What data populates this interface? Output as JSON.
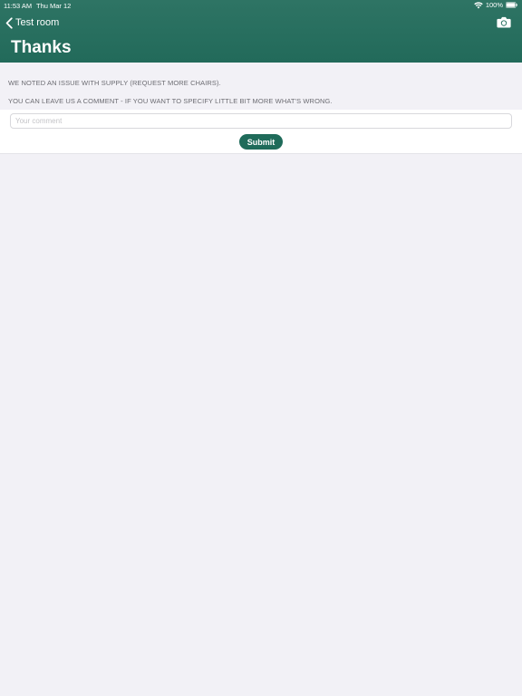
{
  "status_bar": {
    "time": "11:53 AM",
    "date": "Thu Mar 12",
    "battery": "100%"
  },
  "nav": {
    "back_label": "Test room",
    "title": "Thanks"
  },
  "content": {
    "message_1": "WE NOTED AN ISSUE WITH SUPPLY (REQUEST MORE CHAIRS).",
    "message_2": "YOU CAN LEAVE US A COMMENT - IF YOU WANT TO SPECIFY LITTLE BIT MORE WHAT'S WRONG."
  },
  "form": {
    "comment_placeholder": "Your comment",
    "comment_value": "",
    "submit_label": "Submit"
  },
  "icons": {
    "back": "chevron-left-icon",
    "camera": "camera-icon",
    "wifi": "wifi-icon",
    "battery": "battery-icon"
  },
  "colors": {
    "header": "#26705f",
    "accent": "#1f6b5a",
    "background": "#f2f1f6"
  }
}
